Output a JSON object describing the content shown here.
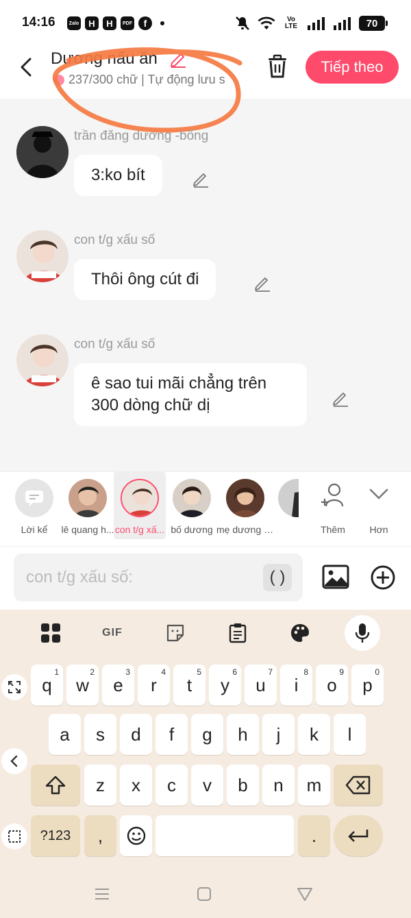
{
  "status_bar": {
    "time": "14:16",
    "app_icons": [
      "Zalo",
      "H",
      "H",
      "PDF",
      "f"
    ],
    "network_label": "Vo LTE",
    "battery": "70"
  },
  "header": {
    "title": "Dương nấu ăn",
    "subtitle": "237/300 chữ | Tự động lưu s",
    "next_label": "Tiếp theo"
  },
  "messages": [
    {
      "sender": "trần đăng dương -bống",
      "text": "3:ko bít"
    },
    {
      "sender": "con t/g xấu số",
      "text": "Thôi ông cút đi"
    },
    {
      "sender": "con t/g xấu số",
      "text": "ê sao tui mãi chẳng trên\n300 dòng chữ dị"
    }
  ],
  "characters": [
    {
      "name": "Lời kể"
    },
    {
      "name": "lê quang h..."
    },
    {
      "name": "con t/g xấ..."
    },
    {
      "name": "bố dương"
    },
    {
      "name": "mẹ dương trần đ"
    },
    {
      "name": ""
    },
    {
      "name": "Thêm"
    },
    {
      "name": "Hơn"
    }
  ],
  "input": {
    "placeholder": "con t/g xấu số:",
    "paren_label": "( )"
  },
  "keyboard": {
    "row1": [
      "q",
      "w",
      "e",
      "r",
      "t",
      "y",
      "u",
      "i",
      "o",
      "p"
    ],
    "row1_nums": [
      "1",
      "2",
      "3",
      "4",
      "5",
      "6",
      "7",
      "8",
      "9",
      "0"
    ],
    "row2": [
      "a",
      "s",
      "d",
      "f",
      "g",
      "h",
      "j",
      "k",
      "l"
    ],
    "row3": [
      "z",
      "x",
      "c",
      "v",
      "b",
      "n",
      "m"
    ],
    "sym_label": "?123",
    "comma": ",",
    "period": ".",
    "gif_label": "GIF"
  },
  "colors": {
    "accent": "#fe4a6b",
    "scribble": "#f47a42",
    "keyboard_bg": "#f5ebe0"
  }
}
